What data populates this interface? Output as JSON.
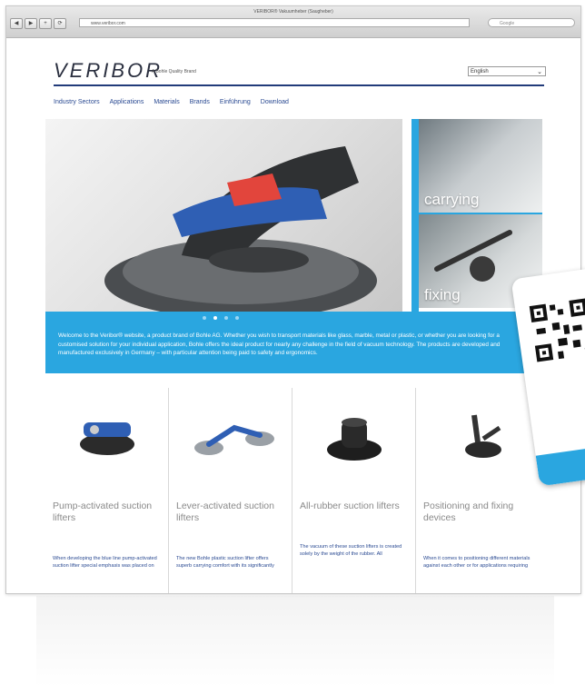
{
  "browser": {
    "window_title": "VERIBOR® Vakuumheber (Saugheber)",
    "url": "www.veribor.com",
    "search_placeholder": "Google",
    "nav_buttons": [
      "◀",
      "▶",
      "+",
      "⟳"
    ]
  },
  "header": {
    "logo": "VERIBOR",
    "tagline": "A Bohle Quality Brand",
    "language": "English"
  },
  "nav": {
    "items": [
      "Industry Sectors",
      "Applications",
      "Materials",
      "Brands",
      "Einführung",
      "Download"
    ]
  },
  "hero": {
    "side_labels": [
      "carrying",
      "fixing"
    ],
    "slides": 4,
    "active_slide": 2
  },
  "welcome": {
    "text": "Welcome to the Veribor® website, a product brand of Bohle AG. Whether you wish to transport materials like glass, marble, metal or plastic, or whether you are looking for a customised solution for your individual application, Bohle offers the ideal product for nearly any challenge in the field of vacuum technology. The products are developed and manufactured exclusively in Germany – with particular attention being paid to safety and ergonomics."
  },
  "products": [
    {
      "title": "Pump-activated suction lifters",
      "desc": "When developing the blue line pump-activated suction lifter special emphasis was placed on"
    },
    {
      "title": "Lever-activated suction lifters",
      "desc": "The new Bohle plastic suction lifter offers superb carrying comfort with its significantly"
    },
    {
      "title": "All-rubber suction lifters",
      "desc": "The vacuum of these suction lifters is created solely by the weight of the rubber. All"
    },
    {
      "title": "Positioning and fixing devices",
      "desc": "When it comes to positioning different materials against each other or for applications requiring"
    }
  ],
  "colors": {
    "accent": "#2aa6e0",
    "brand_navy": "#223b7a",
    "link": "#2a4a92"
  }
}
